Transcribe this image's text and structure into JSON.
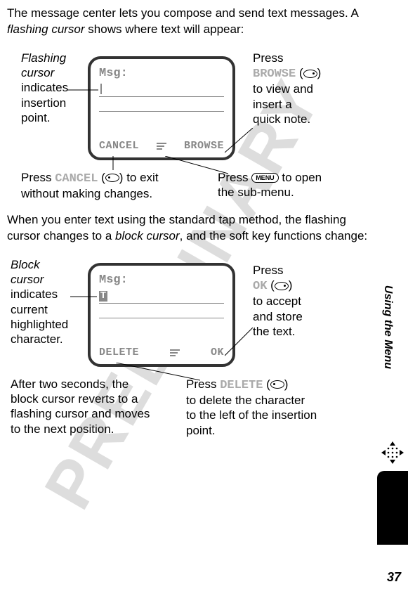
{
  "intro": {
    "sentence_part1": "The message center lets you compose and send text messages. A ",
    "flashing_cursor_term": "flashing cursor",
    "sentence_part2": " shows where text will appear:"
  },
  "diagram1": {
    "screen": {
      "msg_label": "Msg:",
      "softkey_left": "CANCEL",
      "softkey_right": "BROWSE"
    },
    "callout_left": {
      "line1_italic": "Flashing",
      "line2_italic": "cursor",
      "line3": "indicates",
      "line4": "insertion",
      "line5": "point."
    },
    "callout_right": {
      "line1": "Press",
      "line2_mono": "BROWSE",
      "line3": "to view and",
      "line4": "insert a",
      "line5": "quick note."
    },
    "callout_cancel_part1": "Press ",
    "callout_cancel_mono": "CANCEL",
    "callout_cancel_part2": " to exit",
    "callout_cancel_line2": "without making changes.",
    "callout_menu_part1": "Press ",
    "callout_menu_key": "MENU",
    "callout_menu_part2": " to open",
    "callout_menu_line2": "the sub-menu."
  },
  "mid": {
    "part1": "When you enter text using the standard tap method, the flashing cursor changes to a ",
    "block_cursor_term": "block cursor",
    "part2": ", and the soft key functions change:"
  },
  "diagram2": {
    "screen": {
      "msg_label": "Msg:",
      "block_char": "T",
      "softkey_left": "DELETE",
      "softkey_right": "OK"
    },
    "callout_left": {
      "line1_italic": "Block",
      "line2_italic": "cursor",
      "line3": "indicates",
      "line4": "current",
      "line5": "highlighted",
      "line6": "character."
    },
    "callout_right": {
      "line1": "Press",
      "line2_mono": "OK",
      "line3": "to accept",
      "line4": "and store",
      "line5": "the text."
    },
    "callout_revert_l1": "After two seconds, the",
    "callout_revert_l2": "block cursor reverts to a",
    "callout_revert_l3": "flashing cursor and moves",
    "callout_revert_l4": "to the next position.",
    "callout_delete_part1": "Press ",
    "callout_delete_mono": "DELETE",
    "callout_delete_l2": "to delete the character",
    "callout_delete_l3": "to the left of the insertion",
    "callout_delete_l4": "point."
  },
  "side_label": "Using the Menu",
  "page_number": "37"
}
